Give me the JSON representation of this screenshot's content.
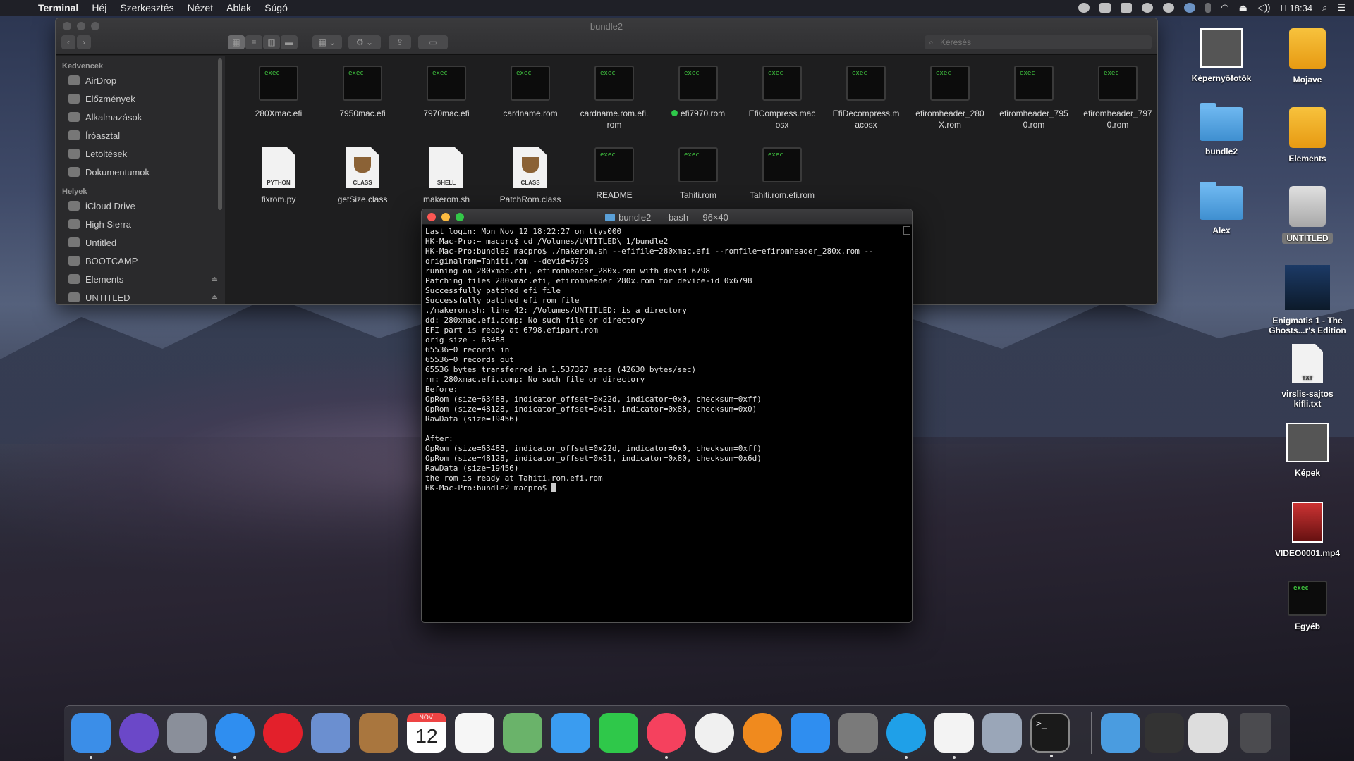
{
  "menubar": {
    "app": "Terminal",
    "items": [
      "Héj",
      "Szerkesztés",
      "Nézet",
      "Ablak",
      "Súgó"
    ],
    "clock": "H 18:34"
  },
  "finder": {
    "title": "bundle2",
    "search_placeholder": "Keresés",
    "sidebar": {
      "favorites_header": "Kedvencek",
      "favorites": [
        "AirDrop",
        "Előzmények",
        "Alkalmazások",
        "Íróasztal",
        "Letöltések",
        "Dokumentumok"
      ],
      "places_header": "Helyek",
      "places": [
        "iCloud Drive",
        "High Sierra",
        "Untitled",
        "BOOTCAMP",
        "Elements",
        "UNTITLED"
      ]
    },
    "files_row1": [
      {
        "name": "280Xmac.efi",
        "kind": "exec"
      },
      {
        "name": "7950mac.efi",
        "kind": "exec"
      },
      {
        "name": "7970mac.efi",
        "kind": "exec"
      },
      {
        "name": "cardname.rom",
        "kind": "exec"
      },
      {
        "name": "cardname.rom.efi.\nrom",
        "kind": "exec"
      },
      {
        "name": "efi7970.rom",
        "kind": "exec",
        "tag": "green"
      },
      {
        "name": "EfiCompress.mac\nosx",
        "kind": "exec"
      },
      {
        "name": "EfiDecompress.m\nacosx",
        "kind": "exec"
      },
      {
        "name": "efiromheader_280\nX.rom",
        "kind": "exec"
      },
      {
        "name": "efiromheader_795\n0.rom",
        "kind": "exec"
      },
      {
        "name": "efiromheader_797\n0.rom",
        "kind": "exec"
      }
    ],
    "files_row2": [
      {
        "name": "fixrom.py",
        "kind": "doc",
        "badge": "PYTHON"
      },
      {
        "name": "getSize.class",
        "kind": "class",
        "badge": "CLASS"
      },
      {
        "name": "makerom.sh",
        "kind": "doc",
        "badge": "SHELL"
      },
      {
        "name": "PatchRom.class",
        "kind": "class",
        "badge": "CLASS"
      },
      {
        "name": "README",
        "kind": "exec"
      },
      {
        "name": "Tahiti.rom",
        "kind": "exec"
      },
      {
        "name": "Tahiti.rom.efi.rom",
        "kind": "exec"
      }
    ],
    "exec_badge": "exec"
  },
  "terminal": {
    "title": "bundle2 — -bash — 96×40",
    "lines": [
      "Last login: Mon Nov 12 18:22:27 on ttys000",
      "HK-Mac-Pro:~ macpro$ cd /Volumes/UNTITLED\\ 1/bundle2",
      "HK-Mac-Pro:bundle2 macpro$ ./makerom.sh --efifile=280xmac.efi --romfile=efiromheader_280x.rom --",
      "originalrom=Tahiti.rom --devid=6798",
      "running on 280xmac.efi, efiromheader_280x.rom with devid 6798",
      "Patching files 280xmac.efi, efiromheader_280x.rom for device-id 0x6798",
      "Successfully patched efi file",
      "Successfully patched efi rom file",
      "./makerom.sh: line 42: /Volumes/UNTITLED: is a directory",
      "dd: 280xmac.efi.comp: No such file or directory",
      "EFI part is ready at 6798.efipart.rom",
      "orig size - 63488",
      "65536+0 records in",
      "65536+0 records out",
      "65536 bytes transferred in 1.537327 secs (42630 bytes/sec)",
      "rm: 280xmac.efi.comp: No such file or directory",
      "Before:",
      "OpRom (size=63488, indicator_offset=0x22d, indicator=0x0, checksum=0xff)",
      "OpRom (size=48128, indicator_offset=0x31, indicator=0x80, checksum=0x0)",
      "RawData (size=19456)",
      "",
      "After:",
      "OpRom (size=63488, indicator_offset=0x22d, indicator=0x0, checksum=0xff)",
      "OpRom (size=48128, indicator_offset=0x31, indicator=0x80, checksum=0x6d)",
      "RawData (size=19456)",
      "the rom is ready at Tahiti.rom.efi.rom",
      "HK-Mac-Pro:bundle2 macpro$ "
    ]
  },
  "desktop": {
    "icons": [
      {
        "label": "Képernyőfotók",
        "kind": "thumb"
      },
      {
        "label": "Mojave",
        "kind": "drive"
      },
      {
        "label": "bundle2",
        "kind": "folder"
      },
      {
        "label": "Elements",
        "kind": "drive"
      },
      {
        "label": "Alex",
        "kind": "folder"
      },
      {
        "label": "UNTITLED",
        "kind": "drive-grey"
      },
      {
        "label": "Enigmatis 1 - The\nGhosts...r's Edition",
        "kind": "game"
      },
      {
        "label": "virslis-sajtos\nkifli.txt",
        "kind": "txt"
      },
      {
        "label": "Képek",
        "kind": "thumb"
      },
      {
        "label": "VIDEO0001.mp4",
        "kind": "video"
      },
      {
        "label": "Egyéb",
        "kind": "exec"
      }
    ],
    "txt_badge": "TXT"
  },
  "dock": {
    "apps": [
      "Finder",
      "Siri",
      "Launchpad",
      "Safari",
      "Opera",
      "Mail",
      "Contacts",
      "Calendar",
      "Reminders",
      "Maps",
      "Messages",
      "FaceTime",
      "iTunes",
      "Photos",
      "iBooks",
      "App Store",
      "System Preferences",
      "Skype",
      "TextEdit",
      "Preview",
      "Terminal"
    ],
    "calendar_month": "NOV.",
    "calendar_day": "12",
    "terminal_glyph": ">_"
  },
  "colors": {
    "exec_green": "#3fc23f",
    "tag_green": "#2ec84a",
    "folder_blue": "#4a9ce0",
    "drive_yellow": "#f0b02a"
  }
}
